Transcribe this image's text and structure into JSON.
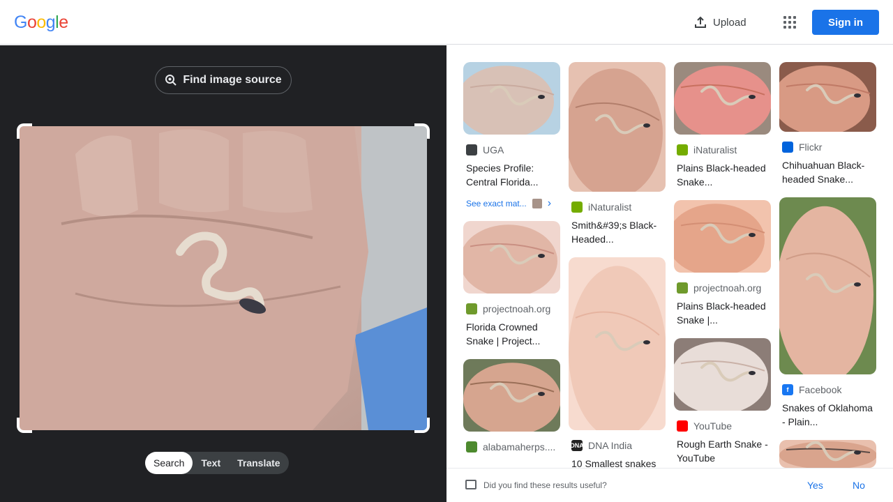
{
  "header": {
    "logo_letters": [
      {
        "ch": "G",
        "color": "#4285F4"
      },
      {
        "ch": "o",
        "color": "#EA4335"
      },
      {
        "ch": "o",
        "color": "#FBBC05"
      },
      {
        "ch": "g",
        "color": "#4285F4"
      },
      {
        "ch": "l",
        "color": "#34A853"
      },
      {
        "ch": "e",
        "color": "#EA4335"
      }
    ],
    "upload_label": "Upload",
    "apps_icon": "apps-grid-icon",
    "signin_label": "Sign in"
  },
  "left": {
    "find_source_label": "Find image source",
    "modes": [
      "Search",
      "Text",
      "Translate"
    ],
    "active_mode": "Search"
  },
  "results": {
    "columns": [
      [
        {
          "source": "UGA",
          "title": "Species Profile: Central Florida...",
          "fav_color": "#3c4043",
          "fav_text": "",
          "exact": "See exact mat...",
          "palette": [
            "#d8c1b6",
            "#c9ab9f",
            "#b7d2e3"
          ]
        },
        {
          "source": "projectnoah.org",
          "title": "Florida Crowned Snake | Project...",
          "fav_color": "#6f9a2c",
          "fav_text": "",
          "palette": [
            "#e1b6a6",
            "#c98f82",
            "#f0d6ce"
          ]
        },
        {
          "source": "alabamaherps....",
          "title": "",
          "fav_color": "#4d8a2e",
          "fav_text": "",
          "palette": [
            "#d6a58f",
            "#9a6f57",
            "#6e7a5a"
          ]
        }
      ],
      [
        {
          "source": "iNaturalist",
          "title": "Smith&#39;s Black-Headed...",
          "fav_color": "#74ac00",
          "fav_text": "",
          "palette": [
            "#d6a390",
            "#b27e6b",
            "#e6c1b1"
          ]
        },
        {
          "source": "DNA India",
          "title": "10 Smallest snakes",
          "fav_color": "#222",
          "fav_text": "DNA",
          "palette": [
            "#f0c9b8",
            "#e6b39f",
            "#f7dbcf"
          ]
        }
      ],
      [
        {
          "source": "iNaturalist",
          "title": "Plains Black-headed Snake...",
          "fav_color": "#74ac00",
          "fav_text": "",
          "palette": [
            "#e6918b",
            "#c8705f",
            "#9a8a7e"
          ]
        },
        {
          "source": "projectnoah.org",
          "title": "Plains Black-headed Snake |...",
          "fav_color": "#6f9a2c",
          "fav_text": "",
          "palette": [
            "#e5a58a",
            "#d38e74",
            "#f2c3ad"
          ]
        },
        {
          "source": "YouTube",
          "title": "Rough Earth Snake - YouTube",
          "fav_color": "#ff0000",
          "fav_text": "",
          "palette": [
            "#e8ddd8",
            "#c9b1a7",
            "#8c7d77"
          ]
        }
      ],
      [
        {
          "source": "Flickr",
          "title": "Chihuahuan Black-headed Snake...",
          "fav_color": "#0063dc",
          "fav_text": "",
          "palette": [
            "#d89a84",
            "#c07a66",
            "#8a5b4b"
          ]
        },
        {
          "source": "Facebook",
          "title": "Snakes of Oklahoma - Plain...",
          "fav_color": "#1877f2",
          "fav_text": "f",
          "palette": [
            "#e4b5a1",
            "#cf9b86",
            "#6d8a4f"
          ]
        },
        {
          "source": "",
          "title": "",
          "fav_color": "#fff",
          "fav_text": "",
          "palette": [
            "#d9a48d",
            "#5a4a45",
            "#e9c0ae"
          ]
        }
      ]
    ]
  },
  "feedback": {
    "question": "Did you find these results useful?",
    "yes": "Yes",
    "no": "No"
  }
}
